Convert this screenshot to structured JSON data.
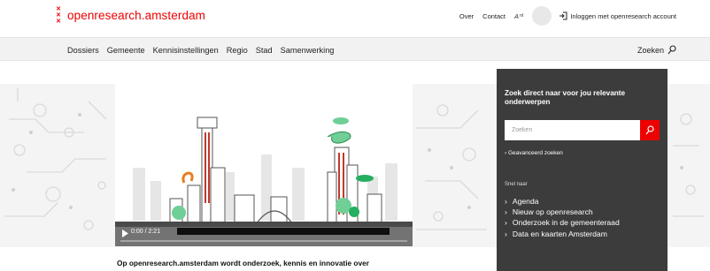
{
  "header": {
    "logo_text": "openresearch.amsterdam",
    "logo_xxx": [
      "✕",
      "✕",
      "✕"
    ],
    "over_label": "Over",
    "contact_label": "Contact",
    "lang_label": "A",
    "lang_sub": "nl",
    "login_label": "Inloggen met openresearch account"
  },
  "mainnav": {
    "items": [
      "Dossiers",
      "Gemeente",
      "Kennisinstellingen",
      "Regio",
      "Stad",
      "Samenwerking"
    ],
    "search_label": "Zoeken"
  },
  "video": {
    "time": "0:00 / 2:21",
    "progress": 0.0
  },
  "panel": {
    "heading": "Zoek direct naar voor jou relevante onderwerpen",
    "search_placeholder": "Zoeken",
    "advanced_label": "Geavanceerd zoeken",
    "snel_label": "Snel naar",
    "links": [
      "Agenda",
      "Nieuw op openresearch",
      "Onderzoek in de gemeenteraad",
      "Data en kaarten Amsterdam"
    ]
  },
  "intro_text": "Op openresearch.amsterdam wordt onderzoek, kennis en innovatie over",
  "colors": {
    "brand": "#ec0000",
    "panel": "#3c3c3c",
    "nav": "#f2f2f2"
  }
}
